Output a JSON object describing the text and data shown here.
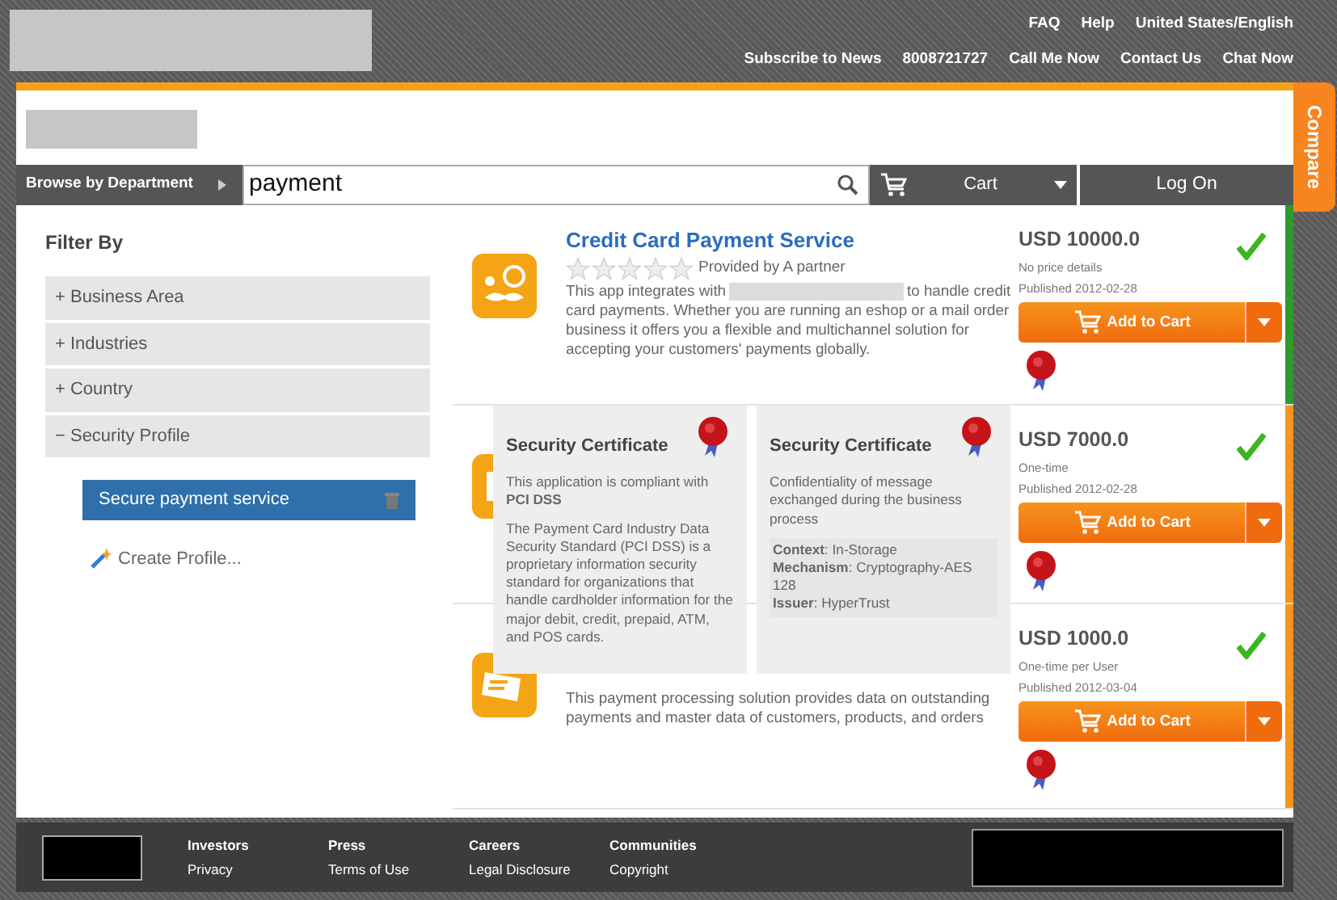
{
  "header": {
    "top_links": [
      "FAQ",
      "Help",
      "United States/English"
    ],
    "sub_links": [
      "Subscribe to News",
      "8008721727",
      "Call Me Now",
      "Contact Us",
      "Chat Now"
    ]
  },
  "navbar": {
    "browse": "Browse by Department",
    "search_value": "payment",
    "cart": "Cart",
    "login": "Log On"
  },
  "filter": {
    "title": "Filter By",
    "groups": [
      {
        "sign": "+",
        "label": "Business Area"
      },
      {
        "sign": "+",
        "label": "Industries"
      },
      {
        "sign": "+",
        "label": "Country"
      },
      {
        "sign": "−",
        "label": "Security Profile",
        "children": [
          {
            "label": "Secure payment service",
            "selected": true
          }
        ]
      }
    ],
    "create": "Create Profile..."
  },
  "results": [
    {
      "title": "Credit Card Payment Service",
      "stars": 0,
      "provider": "Provided by A partner",
      "description_parts": [
        "This app integrates with",
        "to handle credit card payments. Whether you are running an eshop or a mail order business it offers you a flexible and multichannel solution for accepting your customers' payments globally."
      ],
      "price": "USD 10000.0",
      "billing": "No price details",
      "published": "Published 2012-02-28",
      "button": "Add to Cart",
      "check": true,
      "color": "#2e9a2e"
    },
    {
      "price": "USD 7000.0",
      "billing": "One-time",
      "published": "Published 2012-02-28",
      "button": "Add to Cart",
      "check": true,
      "color": "#f7941d"
    },
    {
      "description_parts": [
        "This payment processing solution provides data on outstanding payments and master data of customers, products, and orders"
      ],
      "price": "USD 1000.0",
      "billing": "One-time per User",
      "published": "Published 2012-03-04",
      "button": "Add to Cart",
      "check": true,
      "color": "#f7941d"
    }
  ],
  "popovers": [
    {
      "title": "Security Certificate",
      "paragraphs": [
        "This application is compliant with **PCI DSS**",
        "The Payment Card Industry Data Security Standard (PCI DSS) is a proprietary information security standard for organizations that handle cardholder information for the major debit, credit, prepaid, ATM, and POS cards."
      ]
    },
    {
      "title": "Security Certificate",
      "paragraphs": [
        "Confidentiality of message exchanged during the business process"
      ],
      "details": [
        "**Context**: In-Storage",
        "**Mechanism**: Cryptography-AES 128",
        "**Issuer**: HyperTrust"
      ]
    }
  ],
  "compare": "Compare",
  "footer": {
    "columns": [
      [
        "Investors",
        "Privacy"
      ],
      [
        "Press",
        "Terms of Use"
      ],
      [
        "Careers",
        "Legal Disclosure"
      ],
      [
        "Communities",
        "Copyright"
      ]
    ]
  }
}
